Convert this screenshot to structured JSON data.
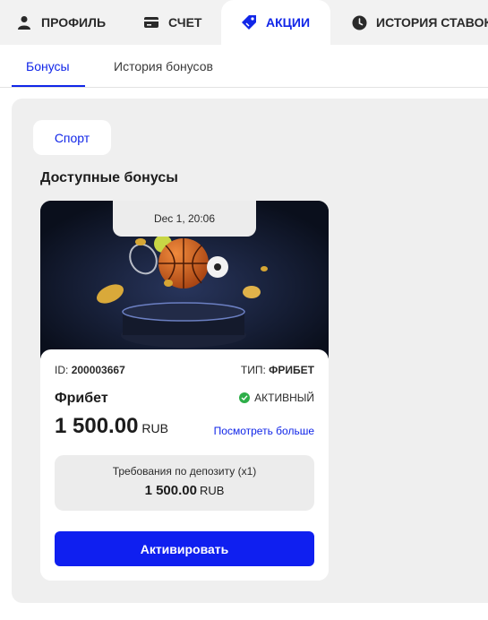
{
  "top_tabs": [
    {
      "label": "ПРОФИЛЬ",
      "icon": "user-icon",
      "active": false
    },
    {
      "label": "СЧЕТ",
      "icon": "wallet-icon",
      "active": false
    },
    {
      "label": "АКЦИИ",
      "icon": "tag-icon",
      "active": true
    },
    {
      "label": "ИСТОРИЯ СТАВОК",
      "icon": "clock-icon",
      "active": false
    }
  ],
  "sub_tabs": [
    {
      "label": "Бонусы",
      "active": true
    },
    {
      "label": "История бонусов",
      "active": false
    }
  ],
  "filter_chip": "Спорт",
  "section_title": "Доступные бонусы",
  "bonus_card": {
    "date": "Dec 1, 20:06",
    "id_label": "ID:",
    "id_value": "200003667",
    "type_label": "ТИП:",
    "type_value": "ФРИБЕТ",
    "name": "Фрибет",
    "status": "АКТИВНЫЙ",
    "amount": "1 500.00",
    "currency": "RUB",
    "more_link": "Посмотреть больше",
    "requirement_label": "Требования по депозиту (x1)",
    "requirement_amount": "1 500.00",
    "requirement_currency": "RUB",
    "activate_label": "Активировать"
  },
  "colors": {
    "accent": "#1126e8",
    "button": "#0f1ff0",
    "status_green": "#2eae49",
    "panel_bg": "#efefef"
  }
}
